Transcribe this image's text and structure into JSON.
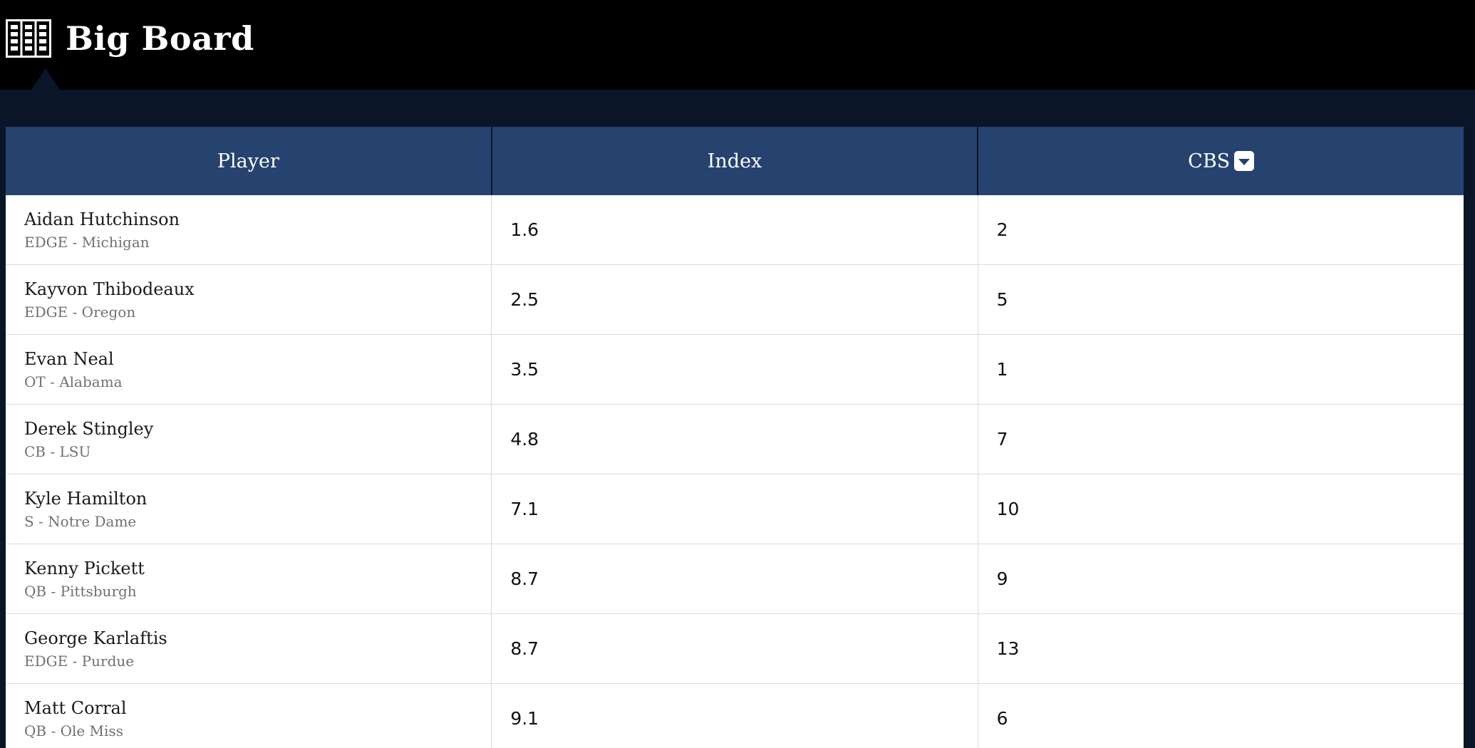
{
  "header": {
    "title": "Big Board",
    "icon": "big-board-icon"
  },
  "table": {
    "columns": [
      {
        "label": "Player"
      },
      {
        "label": "Index"
      },
      {
        "label": "CBS",
        "sort_icon": "sort-down-icon"
      }
    ],
    "rows": [
      {
        "name": "Aidan Hutchinson",
        "meta": "EDGE - Michigan",
        "index": "1.6",
        "cbs": "2"
      },
      {
        "name": "Kayvon Thibodeaux",
        "meta": "EDGE - Oregon",
        "index": "2.5",
        "cbs": "5"
      },
      {
        "name": "Evan Neal",
        "meta": "OT - Alabama",
        "index": "3.5",
        "cbs": "1"
      },
      {
        "name": "Derek Stingley",
        "meta": "CB - LSU",
        "index": "4.8",
        "cbs": "7"
      },
      {
        "name": "Kyle Hamilton",
        "meta": "S - Notre Dame",
        "index": "7.1",
        "cbs": "10"
      },
      {
        "name": "Kenny Pickett",
        "meta": "QB - Pittsburgh",
        "index": "8.7",
        "cbs": "9"
      },
      {
        "name": "George Karlaftis",
        "meta": "EDGE - Purdue",
        "index": "8.7",
        "cbs": "13"
      },
      {
        "name": "Matt Corral",
        "meta": "QB - Ole Miss",
        "index": "9.1",
        "cbs": "6"
      }
    ]
  },
  "colors": {
    "topbar": "#000000",
    "background": "#0a1628",
    "header_row": "#26426f",
    "text": "#1a1a1a",
    "meta_text": "#707070"
  }
}
